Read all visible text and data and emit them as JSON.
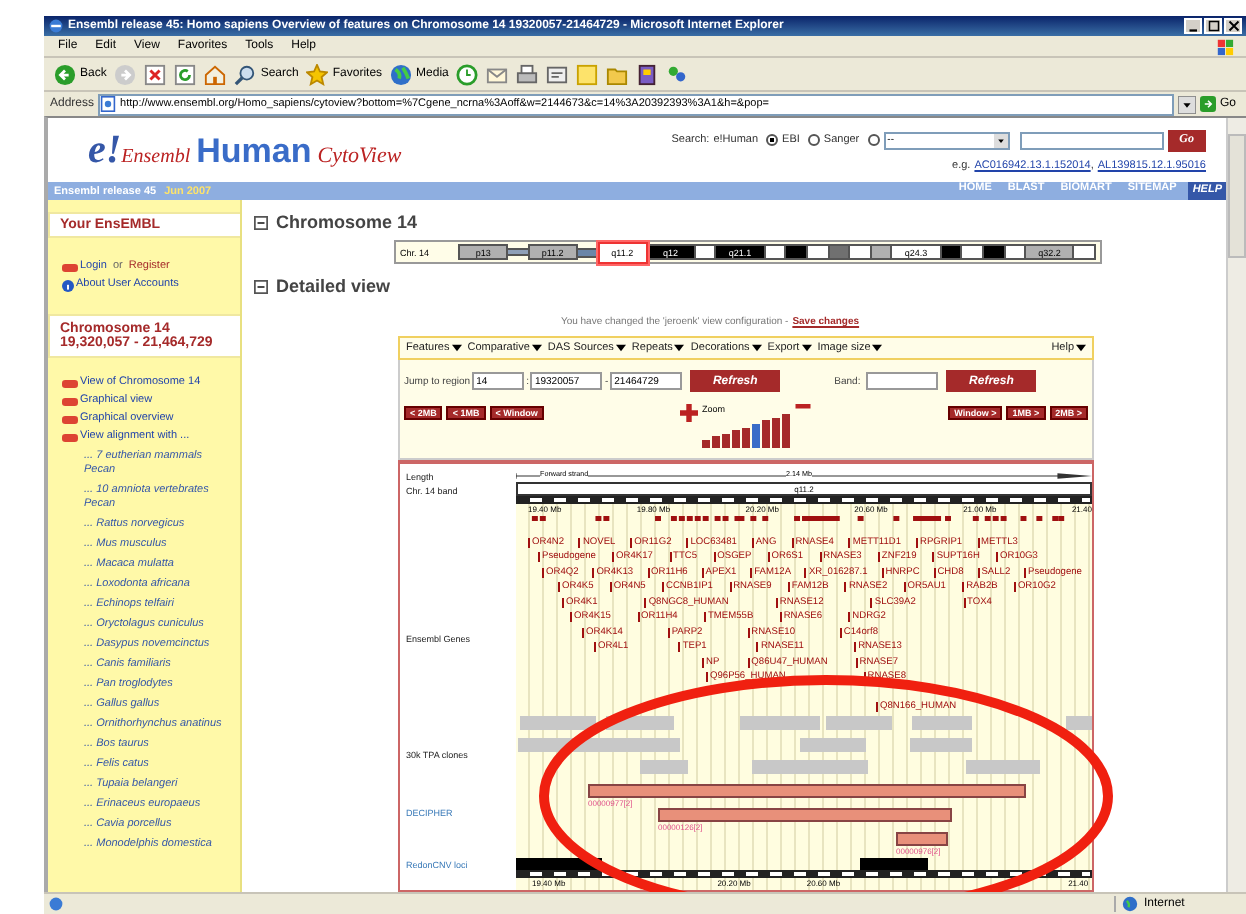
{
  "window": {
    "title": "Ensembl release 45: Homo sapiens Overview of features on Chromosome 14 19320057-21464729 - Microsoft Internet Explorer"
  },
  "menu": [
    "File",
    "Edit",
    "View",
    "Favorites",
    "Tools",
    "Help"
  ],
  "toolbar": [
    {
      "kind": "back",
      "label": "Back"
    },
    {
      "kind": "search",
      "label": "Search"
    },
    {
      "kind": "favorites",
      "label": "Favorites"
    },
    {
      "kind": "media",
      "label": "Media"
    }
  ],
  "address": {
    "label": "Address",
    "url": "http://www.ensembl.org/Homo_sapiens/cytoview?bottom=%7Cgene_ncrna%3Aoff&w=2144673&c=14%3A20392393%3A1&h=&pop=",
    "go": "Go"
  },
  "header": {
    "logo_mark": "e!",
    "logo_word": "Ensembl",
    "species": "Human",
    "view": "CytoView",
    "search": {
      "label": "Search:",
      "scope": "e!Human",
      "radios": [
        {
          "label": "EBI",
          "selected": true
        },
        {
          "label": "Sanger",
          "selected": false
        },
        {
          "selected": false
        }
      ],
      "select": "--",
      "go": "Go"
    },
    "example_label": "e.g.",
    "example_separator": ",",
    "examples": [
      "AC016942.13.1.152014",
      "AL139815.12.1.95016"
    ]
  },
  "navbar": {
    "release": "Ensembl release 45",
    "date": "Jun 2007",
    "links": [
      {
        "label": "HOME",
        "selected": false
      },
      {
        "label": "BLAST",
        "selected": false
      },
      {
        "label": "BIOMART",
        "selected": false
      },
      {
        "label": "SITEMAP",
        "selected": false
      },
      {
        "label": "HELP",
        "selected": true
      }
    ]
  },
  "sidebar": {
    "your_title": "Your EnsEMBL",
    "login": "Login",
    "or": "or",
    "register": "Register",
    "about": "About User Accounts",
    "location_title": "Chromosome 14",
    "location_range": "19,320,057 - 21,464,729",
    "links": [
      {
        "label": "View of Chromosome 14"
      },
      {
        "label": "Graphical view"
      },
      {
        "label": "Graphical overview"
      },
      {
        "label": "View alignment with ...",
        "children": [
          "... 7 eutherian mammals Pecan",
          "... 10 amniota vertebrates Pecan",
          "... Rattus norvegicus",
          "... Mus musculus",
          "... Macaca mulatta",
          "... Loxodonta africana",
          "... Echinops telfairi",
          "... Oryctolagus cuniculus",
          "... Dasypus novemcinctus",
          "... Canis familiaris",
          "... Pan troglodytes",
          "... Gallus gallus",
          "... Ornithorhynchus anatinus",
          "... Bos taurus",
          "... Felis catus",
          "... Tupaia belangeri",
          "... Erinaceus europaeus",
          "... Cavia porcellus",
          "... Monodelphis domestica"
        ]
      }
    ]
  },
  "chromosome": {
    "heading": "Chromosome 14",
    "label": "Chr. 14",
    "bands": [
      {
        "label": "p13",
        "kind": "grey",
        "selected": false
      },
      {
        "kind": "stalk",
        "selected": false
      },
      {
        "label": "p11.2",
        "kind": "grey",
        "selected": false
      },
      {
        "kind": "acen",
        "selected": false
      },
      {
        "label": "q11.2",
        "kind": "white",
        "selected": true
      },
      {
        "label": "q12",
        "kind": "black",
        "selected": false
      },
      {
        "kind": "white",
        "selected": false
      },
      {
        "label": "q21.1",
        "kind": "black",
        "selected": false
      },
      {
        "kind": "white",
        "selected": false
      },
      {
        "kind": "black",
        "selected": false
      },
      {
        "kind": "white",
        "selected": false
      },
      {
        "kind": "dark",
        "selected": false
      },
      {
        "kind": "white",
        "selected": false
      },
      {
        "kind": "grey",
        "selected": false
      },
      {
        "label": "q24.3",
        "kind": "white",
        "selected": false
      },
      {
        "kind": "black",
        "selected": false
      },
      {
        "kind": "white",
        "selected": false
      },
      {
        "kind": "black",
        "selected": false
      },
      {
        "kind": "white",
        "selected": false
      },
      {
        "label": "q32.2",
        "kind": "grey",
        "selected": false
      },
      {
        "kind": "white",
        "selected": false
      }
    ]
  },
  "detail": {
    "heading": "Detailed view",
    "message": "You have changed the 'jeroenk' view configuration -",
    "save": "Save changes",
    "menus": [
      "Features",
      "Comparative",
      "DAS Sources",
      "Repeats",
      "Decorations",
      "Export",
      "Image size"
    ],
    "help": "Help",
    "jump_label": "Jump to region",
    "chr": "14",
    "colon": ":",
    "start": "19320057",
    "dash": "-",
    "end": "21464729",
    "refresh": "Refresh",
    "band_label": "Band:",
    "refresh2": "Refresh",
    "back_buttons": [
      "< 2MB",
      "< 1MB",
      "< Window"
    ],
    "zoom_label": "Zoom",
    "zoom_steps": [
      {
        "selected": false
      },
      {
        "selected": false
      },
      {
        "selected": false
      },
      {
        "selected": false
      },
      {
        "selected": false
      },
      {
        "selected": true
      },
      {
        "selected": false
      },
      {
        "selected": false
      },
      {
        "selected": false
      }
    ],
    "forward_buttons": [
      "Window >",
      "1MB >",
      "2MB >"
    ]
  },
  "tracks": {
    "length_label": "Length",
    "strand": "Forward strand",
    "length": "2.14 Mb",
    "band_label": "Chr. 14 band",
    "band": "q11.2",
    "scale": [
      "19.40 Mb",
      "19.80 Mb",
      "20.20 Mb",
      "20.60 Mb",
      "21.00 Mb",
      "21.40"
    ],
    "genes_label": "Ensembl Genes",
    "gene_rows": [
      [
        "OR4N2",
        "NOVEL",
        "OR11G2",
        "LOC63481",
        "ANG",
        "RNASE4",
        "METT11D1",
        "RPGRIP1",
        "METTL3"
      ],
      [
        "Pseudogene",
        "OR4K17",
        "TTC5",
        "OSGEP",
        "OR6S1",
        "RNASE3",
        "ZNF219",
        "SUPT16H",
        "OR10G3"
      ],
      [
        "OR4Q2",
        "OR4K13",
        "OR11H6",
        "APEX1",
        "FAM12A",
        "XR_016287.1",
        "HNRPC",
        "CHD8",
        "SALL2",
        "Pseudogene"
      ],
      [
        "OR4K5",
        "OR4N5",
        "CCNB1IP1",
        "RNASE9",
        "FAM12B",
        "RNASE2",
        "OR5AU1",
        "RAB2B",
        "OR10G2"
      ],
      [
        "OR4K1",
        "Q8NGC8_HUMAN",
        "RNASE12",
        "SLC39A2",
        "TOX4"
      ],
      [
        "OR4K15",
        "OR11H4",
        "TMEM55B",
        "RNASE6",
        "NDRG2"
      ],
      [
        "OR4K14",
        "PARP2",
        "RNASE10",
        "C14orf8"
      ],
      [
        "OR4L1",
        "TEP1",
        "RNASE11",
        "RNASE13"
      ],
      [
        "NP",
        "Q86U47_HUMAN",
        "RNASE7"
      ],
      [
        "Q96P56_HUMAN",
        "RNASE8"
      ],
      [
        "Q8N166_HUMAN"
      ]
    ],
    "clones_label": "30k TPA clones",
    "decipher_label": "DECIPHER",
    "decipher": [
      "00000977[2]",
      "00000126[2]",
      "00000976[2]"
    ],
    "cnv_label": "RedonCNV loci",
    "bottom_scale": [
      "19.40 Mb",
      "20.20 Mb",
      "20.60 Mb",
      "21.40"
    ]
  },
  "status": {
    "zone": "Internet"
  }
}
